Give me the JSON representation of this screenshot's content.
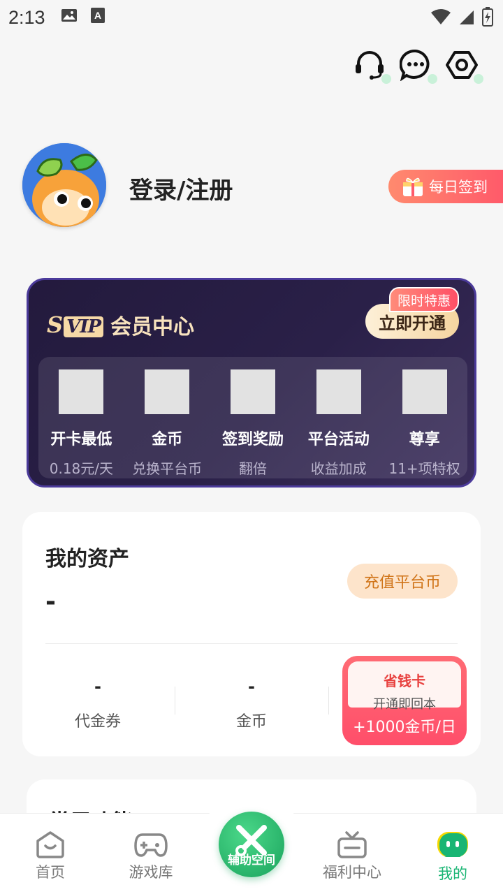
{
  "status_bar": {
    "time": "2:13"
  },
  "profile": {
    "login_text": "登录/注册",
    "checkin_label": "每日签到"
  },
  "svip": {
    "logo_s": "S",
    "logo_vip": "VIP",
    "center_label": "会员中心",
    "limited_tag": "限时特惠",
    "open_label": "立即开通",
    "benefits": [
      {
        "title": "开卡最低",
        "sub": "0.18元/天"
      },
      {
        "title": "金币",
        "sub": "兑换平台币"
      },
      {
        "title": "签到奖励",
        "sub": "翻倍"
      },
      {
        "title": "平台活动",
        "sub": "收益加成"
      },
      {
        "title": "尊享",
        "sub": "11+项特权"
      }
    ]
  },
  "assets": {
    "title": "我的资产",
    "value": "-",
    "recharge_label": "充值平台币",
    "voucher": {
      "value": "-",
      "label": "代金券"
    },
    "coins": {
      "value": "-",
      "label": "金币"
    },
    "save_card": {
      "title": "省钱卡",
      "sub": "开通即回本",
      "reward": "+1000金币/日"
    }
  },
  "common": {
    "title": "常用功能"
  },
  "nav": {
    "home": "首页",
    "library": "游戏库",
    "assist": "辅助空间",
    "welfare": "福利中心",
    "mine": "我的"
  },
  "colors": {
    "accent_green": "#18b573",
    "svip_bg": "#231a3d",
    "svip_gold": "#f6d9a6"
  }
}
